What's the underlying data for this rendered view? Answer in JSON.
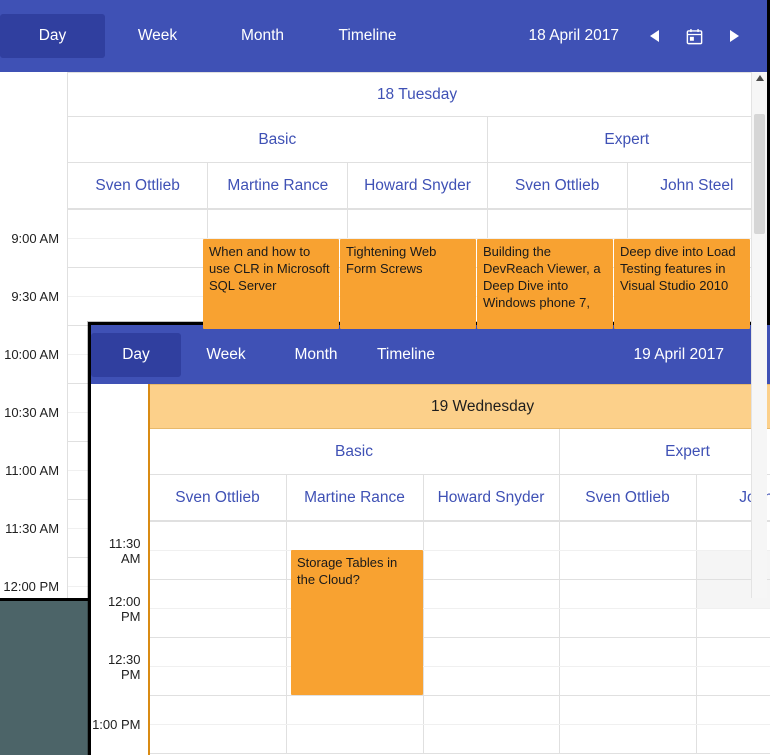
{
  "page": {
    "background_color": "#4c6468",
    "accent_color": "#3f51b5",
    "event_color": "#f8a231",
    "highlight_color": "#fcd08a"
  },
  "scheduler_1": {
    "toolbar": {
      "views": [
        {
          "label": "Day",
          "active": true
        },
        {
          "label": "Week",
          "active": false
        },
        {
          "label": "Month",
          "active": false
        },
        {
          "label": "Timeline",
          "active": false
        }
      ],
      "date_label": "18 April 2017",
      "prev_icon": "triangle-left-icon",
      "today_icon": "calendar-icon",
      "next_icon": "triangle-right-icon"
    },
    "date_header": "18 Tuesday",
    "groups": [
      {
        "label": "Basic",
        "span": 3
      },
      {
        "label": "Expert",
        "span": 2
      }
    ],
    "resources": [
      "Sven Ottlieb",
      "Martine Rance",
      "Howard Snyder",
      "Sven Ottlieb",
      "John Steel"
    ],
    "time_labels": [
      "9:00 AM",
      "9:30 AM",
      "10:00 AM",
      "10:30 AM",
      "11:00 AM",
      "11:30 AM",
      "12:00 PM"
    ],
    "events": [
      {
        "title": "When and how to use CLR in Microsoft SQL Server",
        "column": 1
      },
      {
        "title": "Tightening Web Form Screws",
        "column": 2
      },
      {
        "title": "Building the DevReach Viewer, a Deep Dive into Windows phone 7,",
        "column": 3
      },
      {
        "title": "Deep dive into Load Testing features in Visual Studio 2010",
        "column": 4
      }
    ],
    "scrollbar": {
      "arrow": "scroll-up-arrow-icon"
    }
  },
  "scheduler_2": {
    "toolbar": {
      "views": [
        {
          "label": "Day",
          "active": true
        },
        {
          "label": "Week",
          "active": false
        },
        {
          "label": "Month",
          "active": false
        },
        {
          "label": "Timeline",
          "active": false
        }
      ],
      "date_label": "19 April 2017",
      "prev_icon": "triangle-left-icon"
    },
    "date_header": "19 Wednesday",
    "groups": [
      {
        "label": "Basic",
        "span": 3
      },
      {
        "label": "Expert",
        "span": 2
      }
    ],
    "resources": [
      "Sven Ottlieb",
      "Martine Rance",
      "Howard Snyder",
      "Sven Ottlieb",
      "John"
    ],
    "time_labels": [
      "11:30 AM",
      "12:00 PM",
      "12:30 PM",
      "1:00 PM"
    ],
    "events": [
      {
        "title": "Storage Tables in the Cloud?",
        "column": 1
      }
    ],
    "current_time_marker": true
  }
}
